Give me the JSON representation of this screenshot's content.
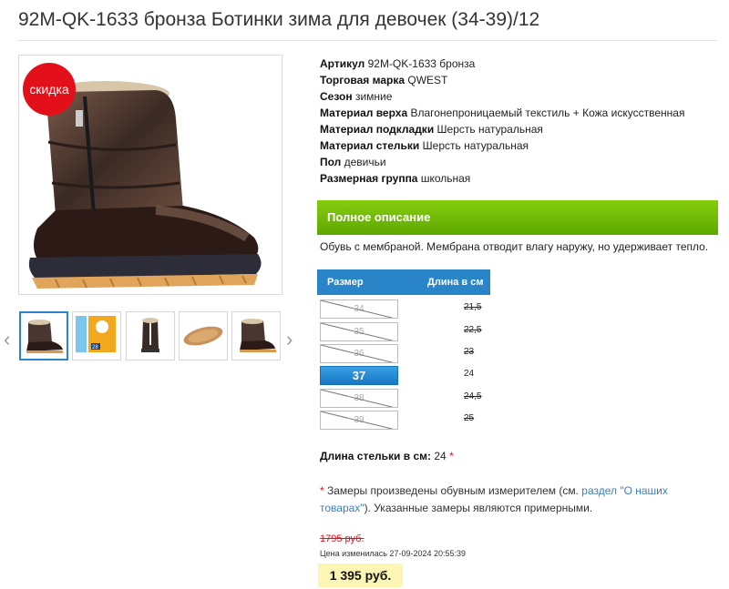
{
  "product": {
    "title": "92M-QK-1633 бронза Ботинки зима для девочек (34-39)/12",
    "sale_badge": "скидка"
  },
  "attributes": [
    {
      "label": "Артикул",
      "value": "92M-QK-1633 бронза"
    },
    {
      "label": "Торговая марка",
      "value": "QWEST"
    },
    {
      "label": "Сезон",
      "value": "зимние"
    },
    {
      "label": "Материал верха",
      "value": "Влагонепроницаемый текстиль + Кожа искусственная"
    },
    {
      "label": "Материал подкладки",
      "value": "Шерсть натуральная"
    },
    {
      "label": "Материал стельки",
      "value": "Шерсть натуральная"
    },
    {
      "label": "Пол",
      "value": "девичьи"
    },
    {
      "label": "Размерная группа",
      "value": "школьная"
    }
  ],
  "description": {
    "header": "Полное описание",
    "text": "Обувь с мембраной. Мембрана отводит влагу наружу, но удерживает тепло."
  },
  "sizes": {
    "header_size": "Размер",
    "header_length": "Длина в см",
    "rows": [
      {
        "size": "34",
        "length": "21,5",
        "available": false,
        "selected": false
      },
      {
        "size": "35",
        "length": "22,5",
        "available": false,
        "selected": false
      },
      {
        "size": "36",
        "length": "23",
        "available": false,
        "selected": false
      },
      {
        "size": "37",
        "length": "24",
        "available": true,
        "selected": true
      },
      {
        "size": "38",
        "length": "24,5",
        "available": false,
        "selected": false
      },
      {
        "size": "39",
        "length": "25",
        "available": false,
        "selected": false
      }
    ]
  },
  "insole": {
    "label": "Длина стельки в см:",
    "value": "24",
    "asterisk": "*"
  },
  "note": {
    "asterisk": "*",
    "text_before": " Замеры произведены обувным измерителем (см. ",
    "link": "раздел \"О наших товарах\"",
    "text_after": "). Указанные замеры являются примерными."
  },
  "pricing": {
    "old_price": "1795 руб.",
    "changed_label": "Цена изменилась 27-09-2024 20:55:39",
    "price": "1 395 руб."
  },
  "gallery": {
    "prev_icon": "‹",
    "next_icon": "›",
    "thumb_label_28": "28"
  },
  "colors": {
    "accent_blue": "#2a84c8",
    "green": "#6dbb04",
    "sale_red": "#e3101a",
    "price_bg": "#fdf5b3"
  }
}
